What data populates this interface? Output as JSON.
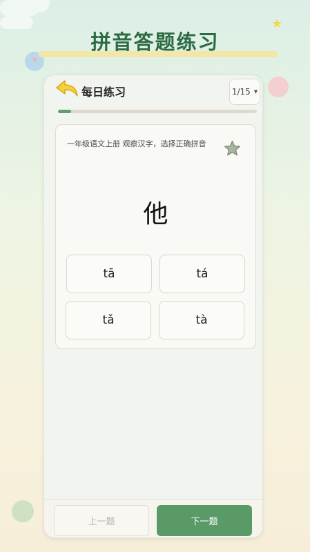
{
  "app": {
    "title": "拼音答题练习"
  },
  "header": {
    "title": "每日练习",
    "page_indicator": "1/15",
    "progress_fraction": 0.067
  },
  "question": {
    "prompt": "一年级语文上册 观察汉字，选择正确拼音",
    "character": "他",
    "options": [
      "tā",
      "tá",
      "tǎ",
      "tà"
    ]
  },
  "footer": {
    "prev_label": "上一题",
    "next_label": "下一题"
  },
  "colors": {
    "accent": "#5a9a67",
    "title": "#2d6b44",
    "progress": "#5fa06d"
  },
  "icons": {
    "back": "back-arrow-icon",
    "favorite": "star-icon",
    "dropdown": "caret-down-icon"
  }
}
